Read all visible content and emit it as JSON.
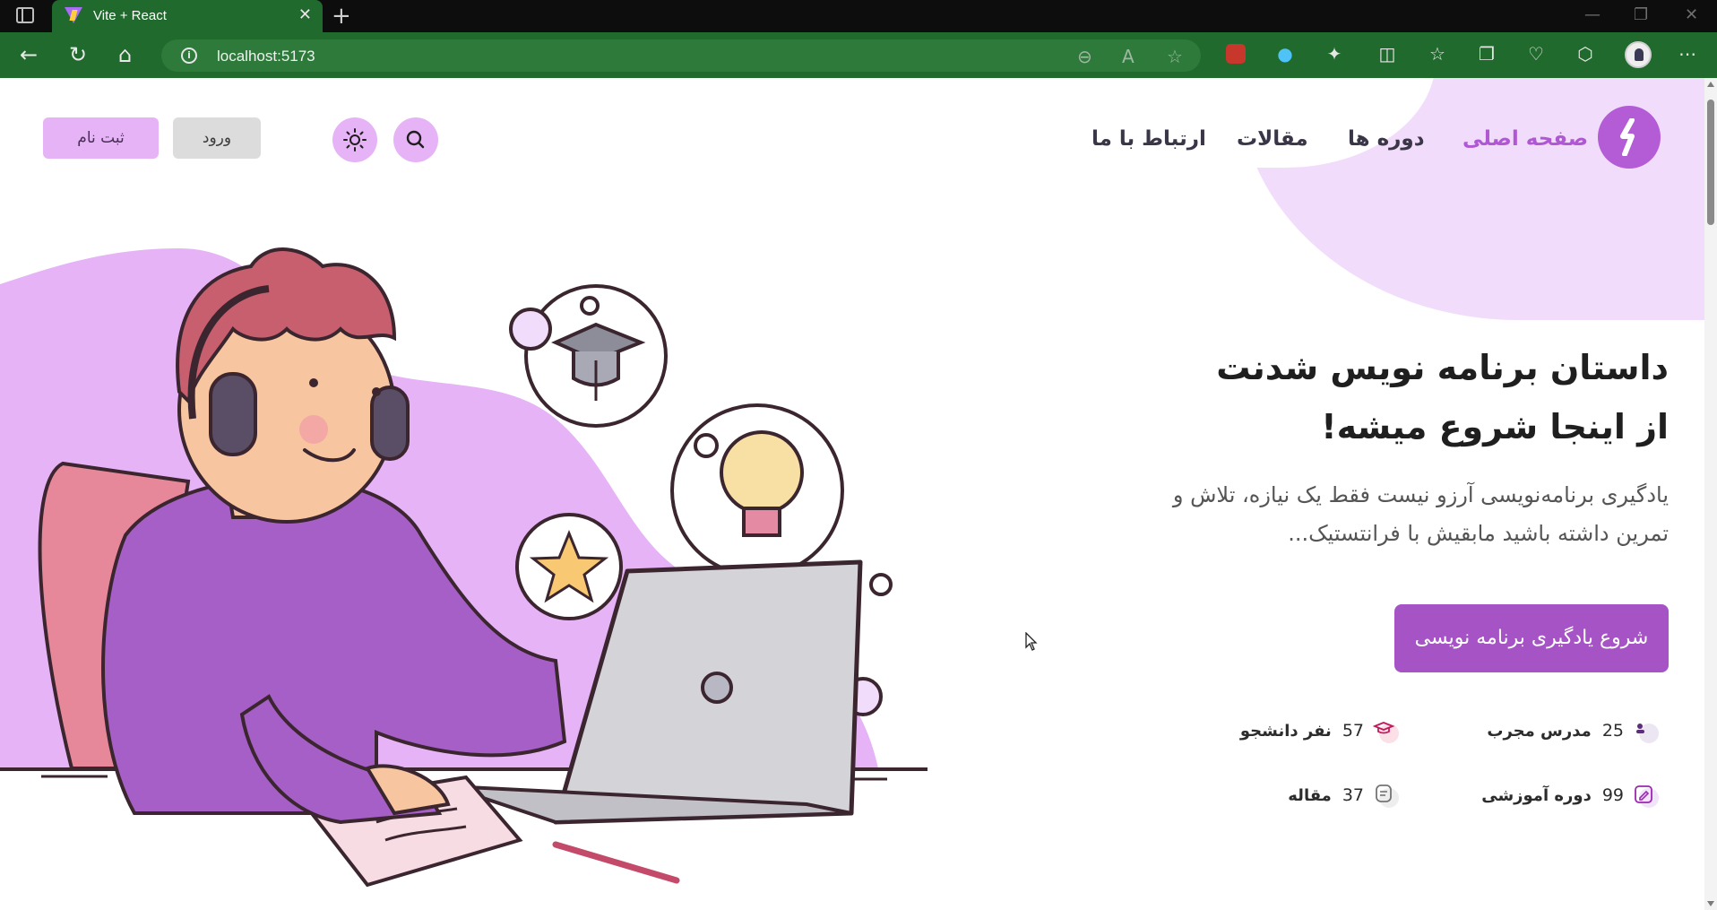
{
  "browser": {
    "tab_title": "Vite + React",
    "tab_close": "✕",
    "new_tab": "+",
    "url": "localhost:5173",
    "icons": [
      "sidebar-toggle-icon",
      "back-icon",
      "reload-icon",
      "home-icon",
      "info-icon",
      "zoom-out-icon",
      "read-aloud-icon",
      "favorite-star-icon",
      "extension-icon",
      "split-screen-icon",
      "favorites-icon",
      "collections-icon",
      "performance-icon",
      "copilot-icon",
      "profile-icon",
      "more-icon"
    ],
    "window_controls": [
      "—",
      "❐",
      "✕"
    ]
  },
  "header": {
    "nav": {
      "home": "صفحه اصلی",
      "courses": "دوره ها",
      "articles": "مقالات",
      "contact": "ارتباط با ما"
    },
    "login": "ورود",
    "register": "ثبت نام"
  },
  "hero": {
    "title_line1": "داستان برنامه نویس شدنت",
    "title_line2": "از اینجا شروع میشه!",
    "description": "یادگیری برنامه‌نویسی آرزو نیست فقط یک نیازه، تلاش و تمرین داشته باشید مابقیش با فرانتستیک...",
    "cta": "شروع یادگیری برنامه نویسی"
  },
  "stats": {
    "teachers": {
      "value": "25",
      "label": "مدرس مجرب"
    },
    "students": {
      "value": "57",
      "label": "نفر دانشجو"
    },
    "courses": {
      "value": "99",
      "label": "دوره آموزشی"
    },
    "articles": {
      "value": "37",
      "label": "مقاله"
    }
  },
  "colors": {
    "brand": "#b058d4",
    "cta": "#a653c6",
    "accent_light": "#e6b3f6",
    "browser_chrome": "#1f6a2c"
  }
}
